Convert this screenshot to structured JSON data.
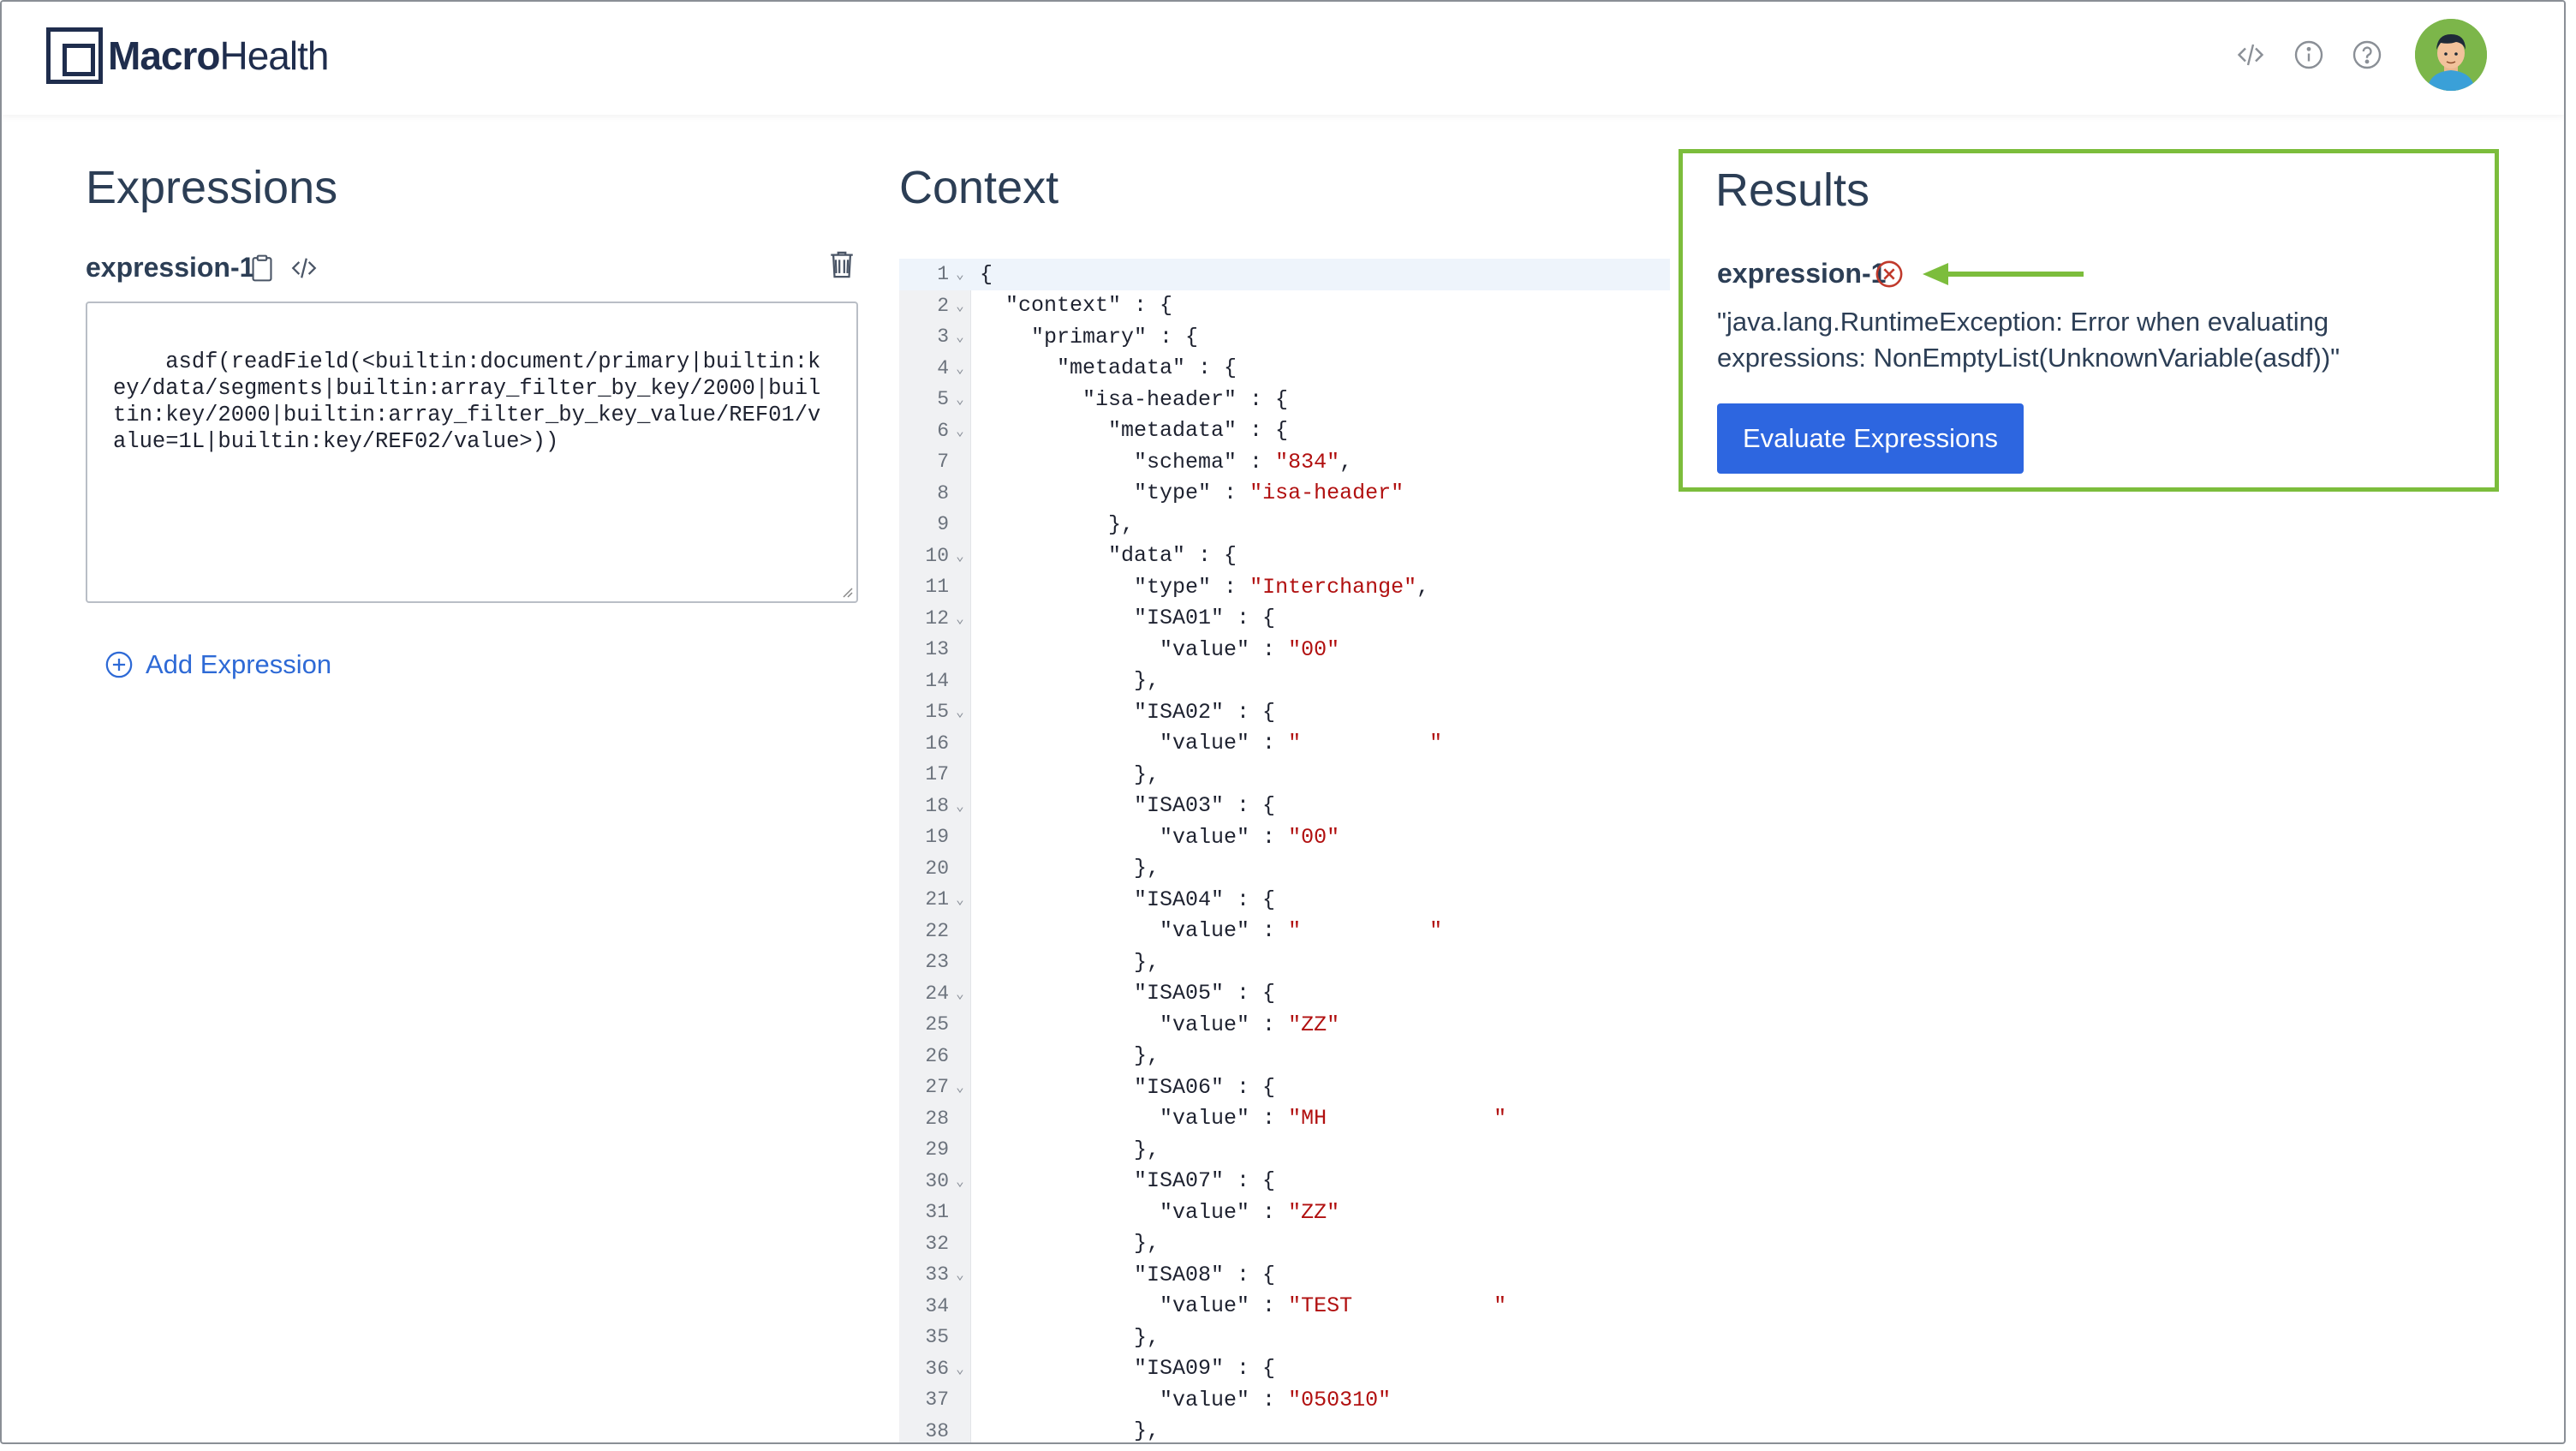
{
  "app": {
    "logo_bold": "Macro",
    "logo_regular": "Health",
    "header_icons": [
      "code-icon",
      "info-icon",
      "help-icon"
    ],
    "avatar": "user-avatar"
  },
  "expressions": {
    "title": "Expressions",
    "items": [
      {
        "label": "expression-1",
        "value": "asdf(readField(<builtin:document/primary|builtin:key/data/segments|builtin:array_filter_by_key/2000|builtin:key/2000|builtin:array_filter_by_key_value/REF01/value=1L|builtin:key/REF02/value>))"
      }
    ],
    "add_label": "Add Expression"
  },
  "context": {
    "title": "Context",
    "lines": [
      {
        "n": "1",
        "fold": true,
        "code": "{"
      },
      {
        "n": "2",
        "fold": true,
        "code": "  \"context\" : {"
      },
      {
        "n": "3",
        "fold": true,
        "code": "    \"primary\" : {"
      },
      {
        "n": "4",
        "fold": true,
        "code": "      \"metadata\" : {"
      },
      {
        "n": "5",
        "fold": true,
        "code": "        \"isa-header\" : {"
      },
      {
        "n": "6",
        "fold": true,
        "code": "          \"metadata\" : {"
      },
      {
        "n": "7",
        "fold": false,
        "code": "            \"schema\" : ",
        "str": "\"834\"",
        "tail": ","
      },
      {
        "n": "8",
        "fold": false,
        "code": "            \"type\" : ",
        "str": "\"isa-header\"",
        "tail": ""
      },
      {
        "n": "9",
        "fold": false,
        "code": "          },"
      },
      {
        "n": "10",
        "fold": true,
        "code": "          \"data\" : {"
      },
      {
        "n": "11",
        "fold": false,
        "code": "            \"type\" : ",
        "str": "\"Interchange\"",
        "tail": ","
      },
      {
        "n": "12",
        "fold": true,
        "code": "            \"ISA01\" : {"
      },
      {
        "n": "13",
        "fold": false,
        "code": "              \"value\" : ",
        "str": "\"00\"",
        "tail": ""
      },
      {
        "n": "14",
        "fold": false,
        "code": "            },"
      },
      {
        "n": "15",
        "fold": true,
        "code": "            \"ISA02\" : {"
      },
      {
        "n": "16",
        "fold": false,
        "code": "              \"value\" : ",
        "str": "\"          \"",
        "tail": ""
      },
      {
        "n": "17",
        "fold": false,
        "code": "            },"
      },
      {
        "n": "18",
        "fold": true,
        "code": "            \"ISA03\" : {"
      },
      {
        "n": "19",
        "fold": false,
        "code": "              \"value\" : ",
        "str": "\"00\"",
        "tail": ""
      },
      {
        "n": "20",
        "fold": false,
        "code": "            },"
      },
      {
        "n": "21",
        "fold": true,
        "code": "            \"ISA04\" : {"
      },
      {
        "n": "22",
        "fold": false,
        "code": "              \"value\" : ",
        "str": "\"          \"",
        "tail": ""
      },
      {
        "n": "23",
        "fold": false,
        "code": "            },"
      },
      {
        "n": "24",
        "fold": true,
        "code": "            \"ISA05\" : {"
      },
      {
        "n": "25",
        "fold": false,
        "code": "              \"value\" : ",
        "str": "\"ZZ\"",
        "tail": ""
      },
      {
        "n": "26",
        "fold": false,
        "code": "            },"
      },
      {
        "n": "27",
        "fold": true,
        "code": "            \"ISA06\" : {"
      },
      {
        "n": "28",
        "fold": false,
        "code": "              \"value\" : ",
        "str": "\"MH             \"",
        "tail": ""
      },
      {
        "n": "29",
        "fold": false,
        "code": "            },"
      },
      {
        "n": "30",
        "fold": true,
        "code": "            \"ISA07\" : {"
      },
      {
        "n": "31",
        "fold": false,
        "code": "              \"value\" : ",
        "str": "\"ZZ\"",
        "tail": ""
      },
      {
        "n": "32",
        "fold": false,
        "code": "            },"
      },
      {
        "n": "33",
        "fold": true,
        "code": "            \"ISA08\" : {"
      },
      {
        "n": "34",
        "fold": false,
        "code": "              \"value\" : ",
        "str": "\"TEST           \"",
        "tail": ""
      },
      {
        "n": "35",
        "fold": false,
        "code": "            },"
      },
      {
        "n": "36",
        "fold": true,
        "code": "            \"ISA09\" : {"
      },
      {
        "n": "37",
        "fold": false,
        "code": "              \"value\" : ",
        "str": "\"050310\"",
        "tail": ""
      },
      {
        "n": "38",
        "fold": false,
        "code": "            },"
      }
    ]
  },
  "results": {
    "title": "Results",
    "items": [
      {
        "label": "expression-1",
        "status": "error",
        "message": "\"java.lang.RuntimeException: Error when evaluating expressions: NonEmptyList(UnknownVariable(asdf))\""
      }
    ],
    "evaluate_label": "Evaluate Expressions",
    "highlight_color": "#7cbd3c",
    "error_color": "#c0392b",
    "button_color": "#2d66e0"
  }
}
